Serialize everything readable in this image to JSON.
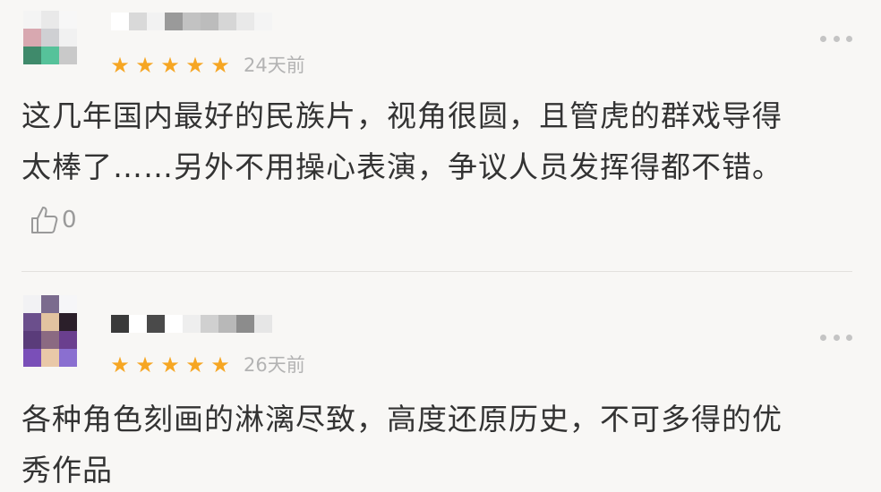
{
  "comments": [
    {
      "avatar_colors": [
        "#f4f4f4",
        "#e9e9e9",
        "#f7f7f7",
        "#d8a8b0",
        "#cfd0d3",
        "#f1f1f1",
        "#3f8a6b",
        "#56c29a",
        "#c9c9c9"
      ],
      "username_blocks": [
        "#ffffff",
        "#d9d9d9",
        "#f2f2f2",
        "#9a9a9a",
        "#c2c2c2",
        "#bcbcbc",
        "#d6d6d6",
        "#e9e9e9",
        "#f4f4f4"
      ],
      "stars": 5,
      "time": "24天前",
      "content": "这几年国内最好的民族片，视角很圆，且管虎的群戏导得\n太棒了……另外不用操心表演，争议人员发挥得都不错。",
      "likes": "0"
    },
    {
      "avatar_colors": [
        "#f2f2f4",
        "#7b6b8e",
        "#f6f6f8",
        "#6b4f8c",
        "#e2c3a0",
        "#2b1f2a",
        "#5a3c7a",
        "#8b6a82",
        "#6a3f8e",
        "#7a4fb8",
        "#e9c8a8",
        "#8a6fd0"
      ],
      "username_blocks": [
        "#3a3a3a",
        "#ffffff",
        "#4a4a4a",
        "#ffffff",
        "#eeeeee",
        "#d0d0d0",
        "#b8b8b8",
        "#8c8c8c",
        "#e6e6e6"
      ],
      "stars": 5,
      "time": "26天前",
      "content": "各种角色刻画的淋漓尽致，高度还原历史，不可多得的优\n秀作品"
    }
  ],
  "colors": {
    "star": "#f6a623",
    "time": "#b3b3b3",
    "text": "#333333",
    "like": "#9a9a9a",
    "background": "#f8f7f5"
  },
  "icons": {
    "like": "thumbs-up-outline-icon",
    "more": "more-dots-icon",
    "star": "star-icon"
  }
}
